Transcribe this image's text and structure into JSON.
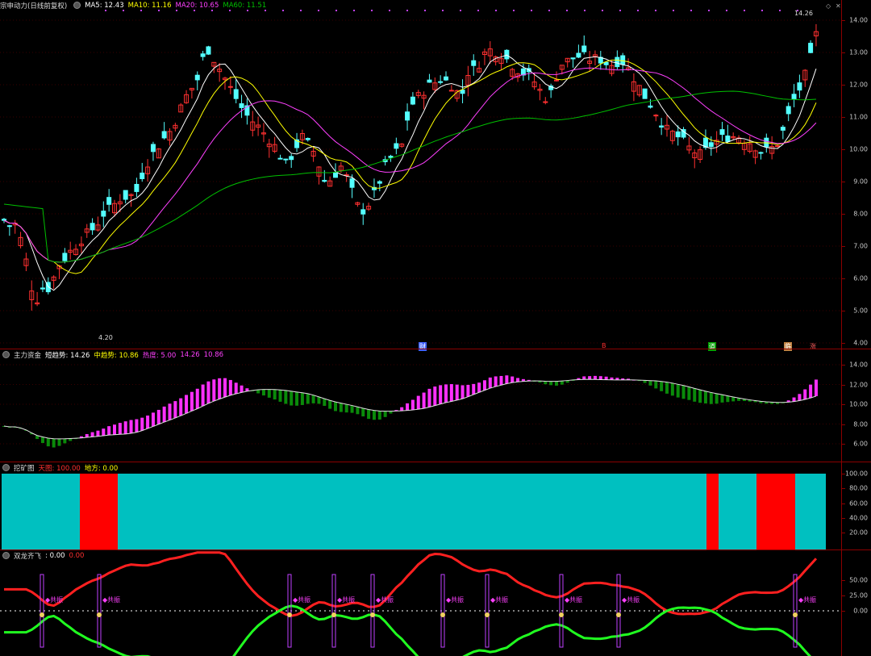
{
  "main": {
    "title": "宗申动力(日线前复权)",
    "ma5": "MA5: 12.43",
    "ma10": "MA10: 11.16",
    "ma20": "MA20: 10.65",
    "ma60": "MA60: 11.51",
    "high_label": "14.26",
    "low_label": "4.20",
    "y_ticks": [
      "14.00",
      "13.00",
      "12.00",
      "11.00",
      "10.00",
      "9.00",
      "8.00",
      "7.00",
      "6.00",
      "5.00",
      "4.00"
    ],
    "markers": [
      "财",
      "B",
      "道",
      "临",
      "涨"
    ]
  },
  "ind1": {
    "title": "主力资金",
    "a": "短趋势: 14.26",
    "b": "中趋势: 10.86",
    "c": "热度: 5.00",
    "d": "14.26",
    "e": "10.86",
    "y_ticks": [
      "14.00",
      "12.00",
      "10.00",
      "8.00",
      "6.00"
    ]
  },
  "ind2": {
    "title": "挖矿图",
    "a": "天图: 100.00",
    "b": "地方: 0.00",
    "y_ticks": [
      "100.00",
      "80.00",
      "60.00",
      "40.00",
      "20.00"
    ]
  },
  "ind3": {
    "title": "双龙齐飞",
    "a": ": 0.00",
    "b": "0.00",
    "y_ticks": [
      "50.00",
      "25.00",
      "0.00"
    ],
    "signal": "共振"
  },
  "colors": {
    "up": "#ff3030",
    "down": "#54ffff",
    "ma5": "#ffffff",
    "ma10": "#ffff00",
    "ma20": "#ff40ff",
    "ma60": "#00c000",
    "sep": "#8b0000"
  }
}
